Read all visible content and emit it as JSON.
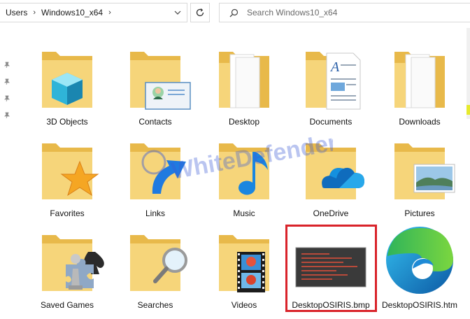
{
  "address_bar": {
    "path": [
      "Users",
      "Windows10_x64"
    ],
    "separator": "›"
  },
  "search": {
    "placeholder": "Search Windows10_x64"
  },
  "watermark": {
    "text": "WhiteDefender"
  },
  "items": [
    {
      "label": "3D Objects",
      "icon": "3d-objects-folder-icon"
    },
    {
      "label": "Contacts",
      "icon": "contacts-folder-icon"
    },
    {
      "label": "Desktop",
      "icon": "desktop-folder-icon"
    },
    {
      "label": "Documents",
      "icon": "documents-folder-icon"
    },
    {
      "label": "Downloads",
      "icon": "downloads-folder-icon"
    },
    {
      "label": "Favorites",
      "icon": "favorites-folder-icon"
    },
    {
      "label": "Links",
      "icon": "links-folder-icon"
    },
    {
      "label": "Music",
      "icon": "music-folder-icon"
    },
    {
      "label": "OneDrive",
      "icon": "onedrive-folder-icon"
    },
    {
      "label": "Pictures",
      "icon": "pictures-folder-icon"
    },
    {
      "label": "Saved Games",
      "icon": "saved-games-folder-icon"
    },
    {
      "label": "Searches",
      "icon": "searches-folder-icon"
    },
    {
      "label": "Videos",
      "icon": "videos-folder-icon"
    },
    {
      "label": "DesktopOSIRIS.bmp",
      "icon": "bmp-file-thumbnail",
      "highlighted": true
    },
    {
      "label": "DesktopOSIRIS.htm",
      "icon": "edge-html-file-icon"
    }
  ],
  "colors": {
    "folder": "#f6d57a",
    "folder_dark": "#e8b94a",
    "highlight": "#d9232a",
    "watermark": "#3b5bd6"
  }
}
